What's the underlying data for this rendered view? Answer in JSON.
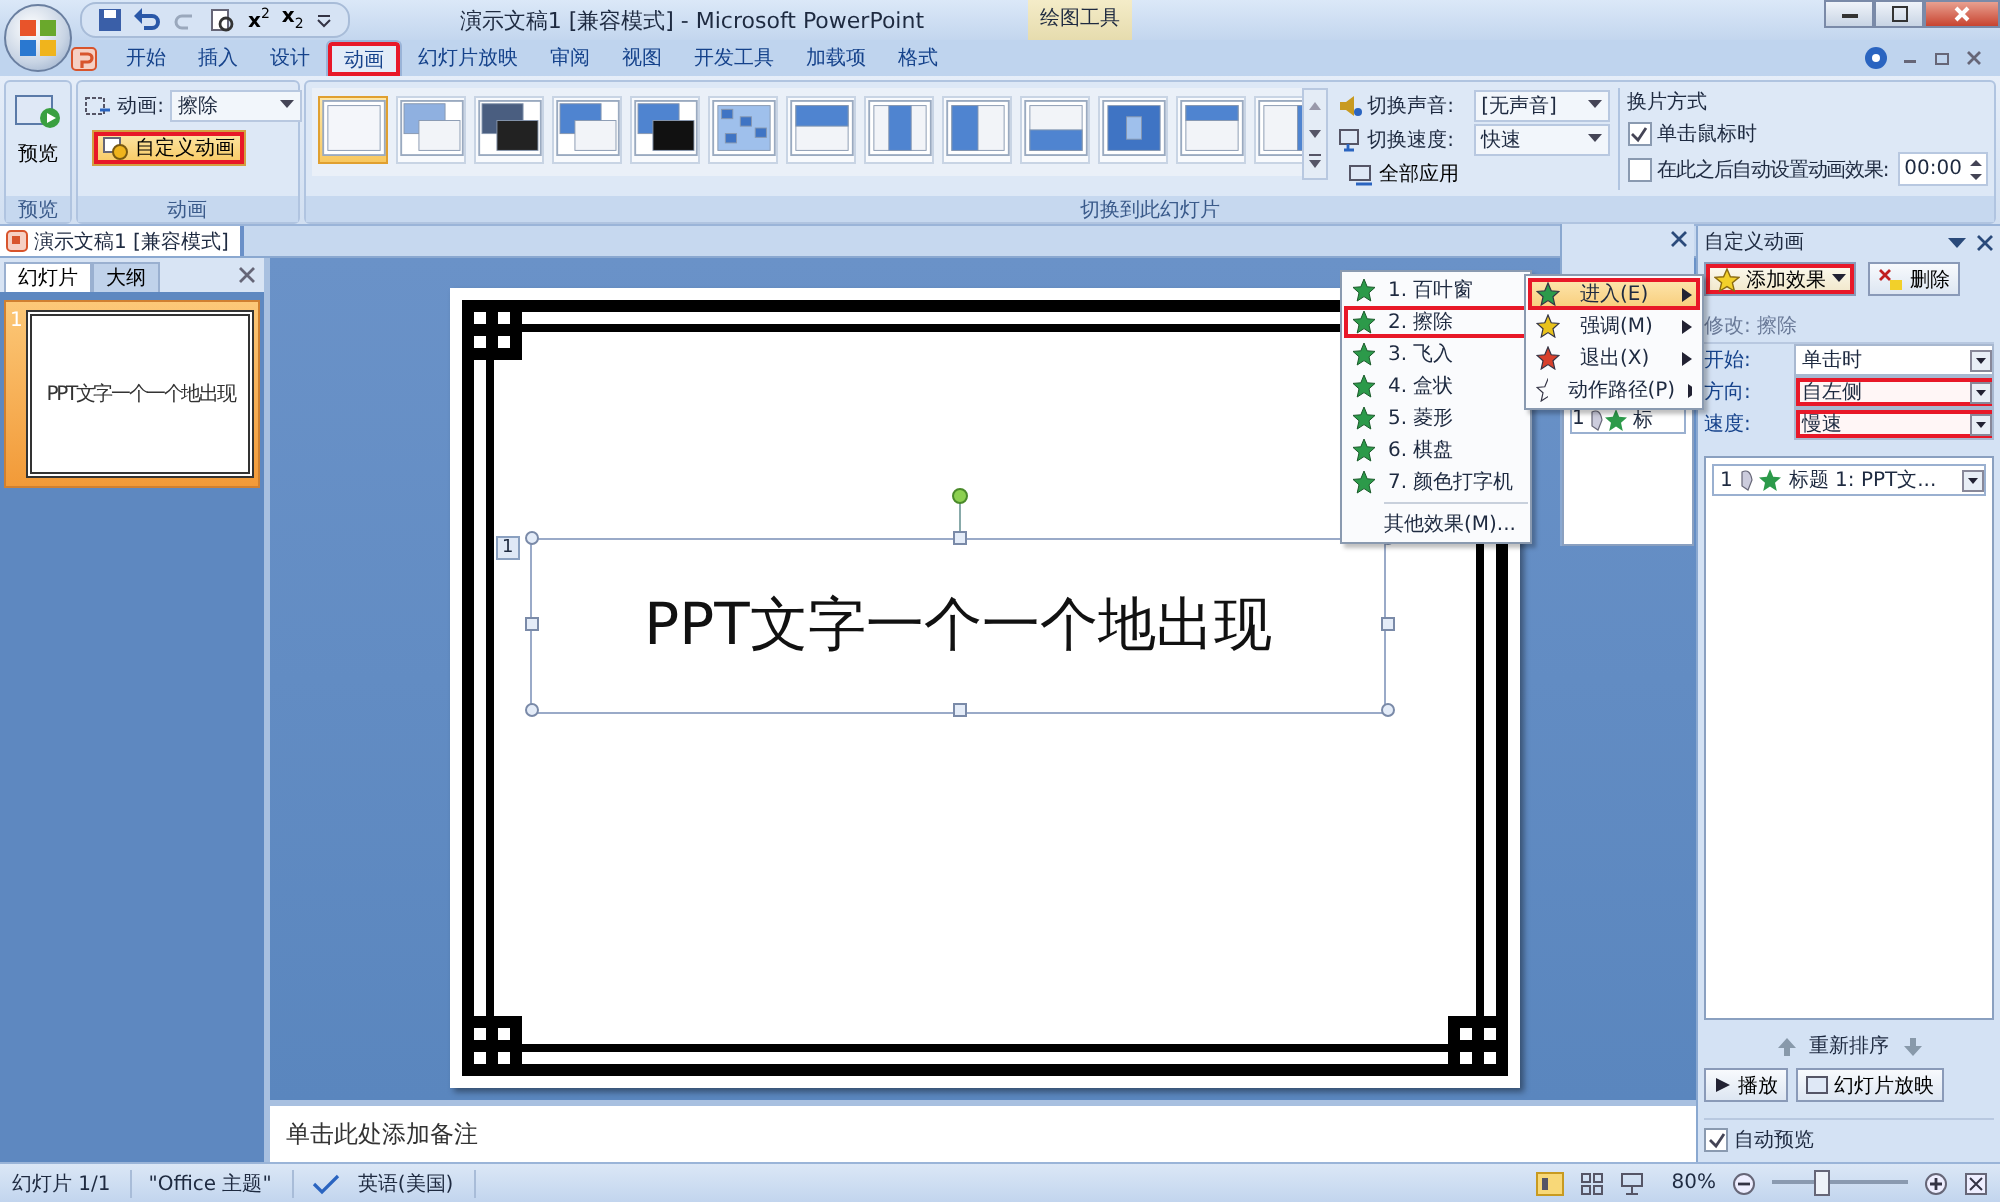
{
  "window": {
    "title": "演示文稿1 [兼容模式] - Microsoft PowerPoint",
    "context_tab": "绘图工具"
  },
  "quick_access": [
    {
      "kind": "superscript",
      "base": "x",
      "index": "2"
    },
    {
      "kind": "subscript",
      "base": "x",
      "index": "2"
    }
  ],
  "ribbon_tabs": [
    {
      "label": "开始",
      "selected": false,
      "highlighted": false
    },
    {
      "label": "插入",
      "selected": false,
      "highlighted": false
    },
    {
      "label": "设计",
      "selected": false,
      "highlighted": false
    },
    {
      "label": "动画",
      "selected": true,
      "highlighted": true
    },
    {
      "label": "幻灯片放映",
      "selected": false,
      "highlighted": false
    },
    {
      "label": "审阅",
      "selected": false,
      "highlighted": false
    },
    {
      "label": "视图",
      "selected": false,
      "highlighted": false
    },
    {
      "label": "开发工具",
      "selected": false,
      "highlighted": false
    },
    {
      "label": "加载项",
      "selected": false,
      "highlighted": false
    },
    {
      "label": "格式",
      "selected": false,
      "highlighted": false
    }
  ],
  "ribbon": {
    "preview": {
      "button": "预览",
      "group": "预览"
    },
    "animation": {
      "group": "动画",
      "label": "动画:",
      "value": "擦除",
      "custom_button": "自定义动画",
      "custom_highlighted": true
    },
    "transitions": {
      "group": "切换到此幻灯片",
      "thumbs": [
        {
          "kind": "none",
          "selected": true
        },
        {
          "kind": "fade",
          "selected": false
        },
        {
          "kind": "fade-black",
          "selected": false
        },
        {
          "kind": "cut",
          "selected": false
        },
        {
          "kind": "cut-black",
          "selected": false
        },
        {
          "kind": "dissolve",
          "selected": false
        },
        {
          "kind": "wipe-down",
          "selected": false
        },
        {
          "kind": "split-in",
          "selected": false
        },
        {
          "kind": "split-out",
          "selected": false
        },
        {
          "kind": "wipe-up",
          "selected": false
        },
        {
          "kind": "wheel",
          "selected": false
        },
        {
          "kind": "cover-down",
          "selected": false
        },
        {
          "kind": "push-left",
          "selected": false
        }
      ]
    },
    "sound": {
      "label": "切换声音:",
      "value": "[无声音]"
    },
    "speed": {
      "label": "切换速度:",
      "value": "快速"
    },
    "apply_all": "全部应用",
    "advance": {
      "title": "换片方式",
      "on_click": {
        "label": "单击鼠标时",
        "checked": true
      },
      "after": {
        "label": "在此之后自动设置动画效果:",
        "checked": false,
        "value": "00:00"
      }
    }
  },
  "document_tab": "演示文稿1 [兼容模式]",
  "slides_pane": {
    "tabs": [
      {
        "label": "幻灯片",
        "selected": true
      },
      {
        "label": "大纲",
        "selected": false
      }
    ],
    "thumbnails": [
      {
        "number": "1",
        "title": "PPT文字一个一个地出现",
        "selected": true
      }
    ]
  },
  "slide": {
    "title": "PPT文字一个一个地出现",
    "animation_tag": "1"
  },
  "notes_placeholder": "单击此处添加备注",
  "back_pane": {
    "item_number": "1",
    "item_text": "标"
  },
  "effect_menu": {
    "items": [
      {
        "label": "进入(E)",
        "kind": "enter",
        "selected": true,
        "highlighted": true
      },
      {
        "label": "强调(M)",
        "kind": "emphasis",
        "selected": false,
        "highlighted": false
      },
      {
        "label": "退出(X)",
        "kind": "exit",
        "selected": false,
        "highlighted": false
      },
      {
        "label": "动作路径(P)",
        "kind": "path",
        "selected": false,
        "highlighted": false
      }
    ],
    "submenu": [
      {
        "label": "1. 百叶窗",
        "highlighted": false
      },
      {
        "label": "2. 擦除",
        "highlighted": true
      },
      {
        "label": "3. 飞入",
        "highlighted": false
      },
      {
        "label": "4. 盒状",
        "highlighted": false
      },
      {
        "label": "5. 菱形",
        "highlighted": false
      },
      {
        "label": "6. 棋盘",
        "highlighted": false
      },
      {
        "label": "7. 颜色打字机",
        "highlighted": false
      }
    ],
    "more": "其他效果(M)..."
  },
  "task_pane": {
    "title": "自定义动画",
    "add_button": "添加效果",
    "add_highlighted": true,
    "delete_button": "删除",
    "modify": "修改: 擦除",
    "fields": [
      {
        "label": "开始:",
        "value": "单击时",
        "highlighted": false
      },
      {
        "label": "方向:",
        "value": "自左侧",
        "highlighted": true
      },
      {
        "label": "速度:",
        "value": "慢速",
        "highlighted": true
      }
    ],
    "list": [
      {
        "number": "1",
        "text": "标题 1: PPT文...",
        "selected": false
      }
    ],
    "reorder": "重新排序",
    "play": "播放",
    "slideshow": "幻灯片放映",
    "autopreview": {
      "label": "自动预览",
      "checked": true
    }
  },
  "status_bar": {
    "slide": "幻灯片 1/1",
    "theme": "\"Office 主题\"",
    "language": "英语(美国)",
    "zoom": "80%",
    "level": 0.36
  }
}
